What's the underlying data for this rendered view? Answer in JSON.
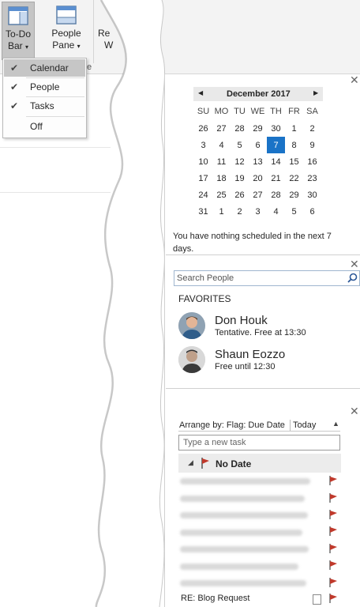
{
  "ribbon": {
    "todo_bar": {
      "line1": "To-Do",
      "line2": "Bar"
    },
    "people_pane": {
      "line1": "People",
      "line2": "Pane"
    },
    "reading_cut": {
      "line1": "Re",
      "line2": "W"
    },
    "group_suffix": "e"
  },
  "todo_menu": {
    "items": [
      {
        "label": "Calendar",
        "checked": true,
        "highlighted": true
      },
      {
        "label": "People",
        "checked": true
      },
      {
        "label": "Tasks",
        "checked": true
      },
      {
        "label": "Off",
        "checked": false
      }
    ]
  },
  "calendar": {
    "month_label": "December 2017",
    "prev_arrow": "◀",
    "next_arrow": "▶",
    "weekdays": [
      "SU",
      "MO",
      "TU",
      "WE",
      "TH",
      "FR",
      "SA"
    ],
    "weeks": [
      [
        "26",
        "27",
        "28",
        "29",
        "30",
        "1",
        "2"
      ],
      [
        "3",
        "4",
        "5",
        "6",
        "7",
        "8",
        "9"
      ],
      [
        "10",
        "11",
        "12",
        "13",
        "14",
        "15",
        "16"
      ],
      [
        "17",
        "18",
        "19",
        "20",
        "21",
        "22",
        "23"
      ],
      [
        "24",
        "25",
        "26",
        "27",
        "28",
        "29",
        "30"
      ],
      [
        "31",
        "1",
        "2",
        "3",
        "4",
        "5",
        "6"
      ]
    ],
    "today": "7",
    "empty_message": "You have nothing scheduled in the next 7 days."
  },
  "people": {
    "search_placeholder": "Search People",
    "favorites_heading": "FAVORITES",
    "contacts": [
      {
        "name": "Don Houk",
        "status": "Tentative.  Free at 13:30"
      },
      {
        "name": "Shaun Eozzo",
        "status": "Free until 12:30"
      }
    ]
  },
  "tasks": {
    "arrange_label": "Arrange by: Flag: Due Date",
    "sort_label": "Today",
    "new_task_placeholder": "Type a new task",
    "group_label": "No Date",
    "last_task": "RE: Blog Request"
  },
  "colors": {
    "accent": "#1a73c7",
    "flag": "#c0392b"
  }
}
